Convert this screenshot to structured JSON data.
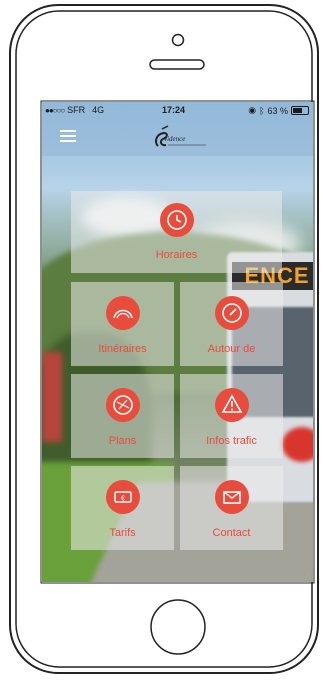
{
  "status_bar": {
    "carrier": "SFR",
    "network": "4G",
    "time": "17:24",
    "battery": "63 %",
    "battery_level": 0.63
  },
  "app_bar": {
    "logo_text": "vidence"
  },
  "background": {
    "bus_sign": "ENCE"
  },
  "tiles": [
    {
      "label": "Horaires"
    },
    {
      "label": "Itinéraires"
    },
    {
      "label": "Autour de"
    },
    {
      "label": "Plans"
    },
    {
      "label": "Infos trafic"
    },
    {
      "label": "Tarifs"
    },
    {
      "label": "Contact"
    }
  ],
  "colors": {
    "accent": "#e74c3c",
    "tile_bg": "rgba(235,235,235,0.55)",
    "bar_bg": "rgba(150,185,215,0.65)"
  }
}
